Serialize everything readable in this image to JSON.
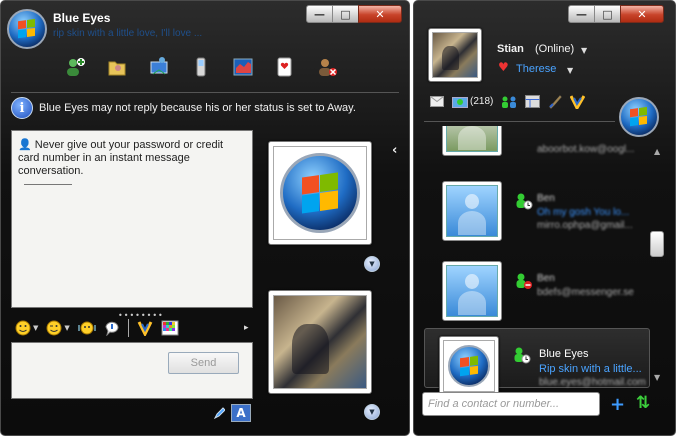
{
  "chat_window": {
    "title": "Blue Eyes",
    "psm": "rip skin with a little love, I'll love ...",
    "controls": {
      "minimize": "—",
      "maximize": "□",
      "close": "✕"
    },
    "toolbar_icons": [
      "invite-contact-icon",
      "send-files-icon",
      "video-call-icon",
      "call-phone-icon",
      "activities-icon",
      "games-icon",
      "block-contact-icon"
    ],
    "away_notice": "Blue Eyes may not reply because his or her status is set to Away.",
    "security_warning": "Never give out your password or credit card number in an instant message conversation.",
    "format_icons": [
      "emoticon-icon",
      "wink-icon",
      "nudge-icon",
      "voice-clip-icon",
      "font-icon",
      "background-icon"
    ],
    "send_label": "Send",
    "resize_grip": "••••••••",
    "more_arrow": "▸",
    "tile_expand": "▼"
  },
  "contact_window": {
    "user_name": "Stian",
    "user_status": "(Online)",
    "user_psm": "Therese",
    "mail_count": "(218)",
    "contacts": [
      {
        "name": "",
        "psm": "",
        "email": "aboorbot.kow@oogl..."
      },
      {
        "name": "Ben",
        "psm": "Oh my gosh You lo...",
        "email": "mirro.ophpa@gmail..."
      },
      {
        "name": "Ben",
        "psm": "",
        "email": "bdefs@messenger.se"
      },
      {
        "name": "Blue Eyes",
        "psm": "Rip skin with a little...",
        "email": "blue.eyes@hotmail.com"
      }
    ],
    "search_placeholder": "Find a contact or number...",
    "add_label": "+",
    "sort_label": "⇅",
    "controls": {
      "minimize": "—",
      "maximize": "□",
      "close": "✕"
    }
  }
}
